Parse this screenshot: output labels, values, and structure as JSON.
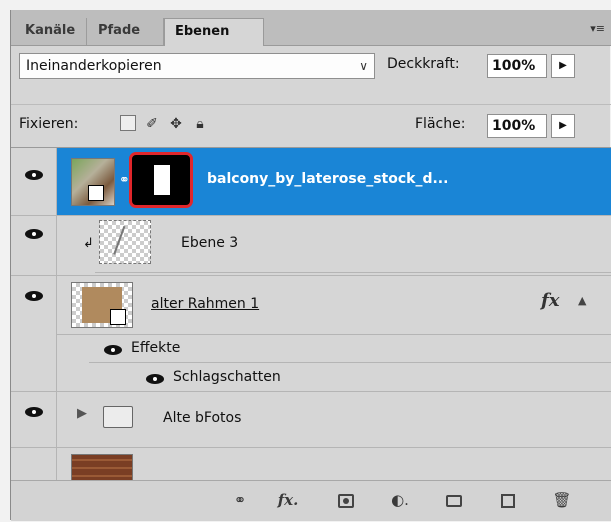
{
  "tabs": [
    {
      "label": "Kanäle"
    },
    {
      "label": "Pfade"
    },
    {
      "label": "Ebenen"
    }
  ],
  "blend_mode": {
    "value": "Ineinanderkopieren"
  },
  "opacity": {
    "label": "Deckkraft:",
    "value": "100%"
  },
  "lock": {
    "label": "Fixieren:"
  },
  "fill": {
    "label": "Fläche:",
    "value": "100%"
  },
  "layers": [
    {
      "name": "balcony_by_laterose_stock_d...",
      "selected": true
    },
    {
      "name": "Ebene 3"
    },
    {
      "name": "alter Rahmen 1",
      "fx": "fx"
    },
    {
      "name": "Effekte"
    },
    {
      "name": "Schlagschatten"
    },
    {
      "name": "Alte bFotos"
    }
  ],
  "colors": {
    "selection": "#1a85d6",
    "mask_highlight": "#e0262b"
  },
  "icons": [
    "eye-icon",
    "link-icon",
    "fx-icon",
    "mask-icon",
    "adjustment-icon",
    "folder-icon",
    "new-layer-icon",
    "trash-icon"
  ]
}
